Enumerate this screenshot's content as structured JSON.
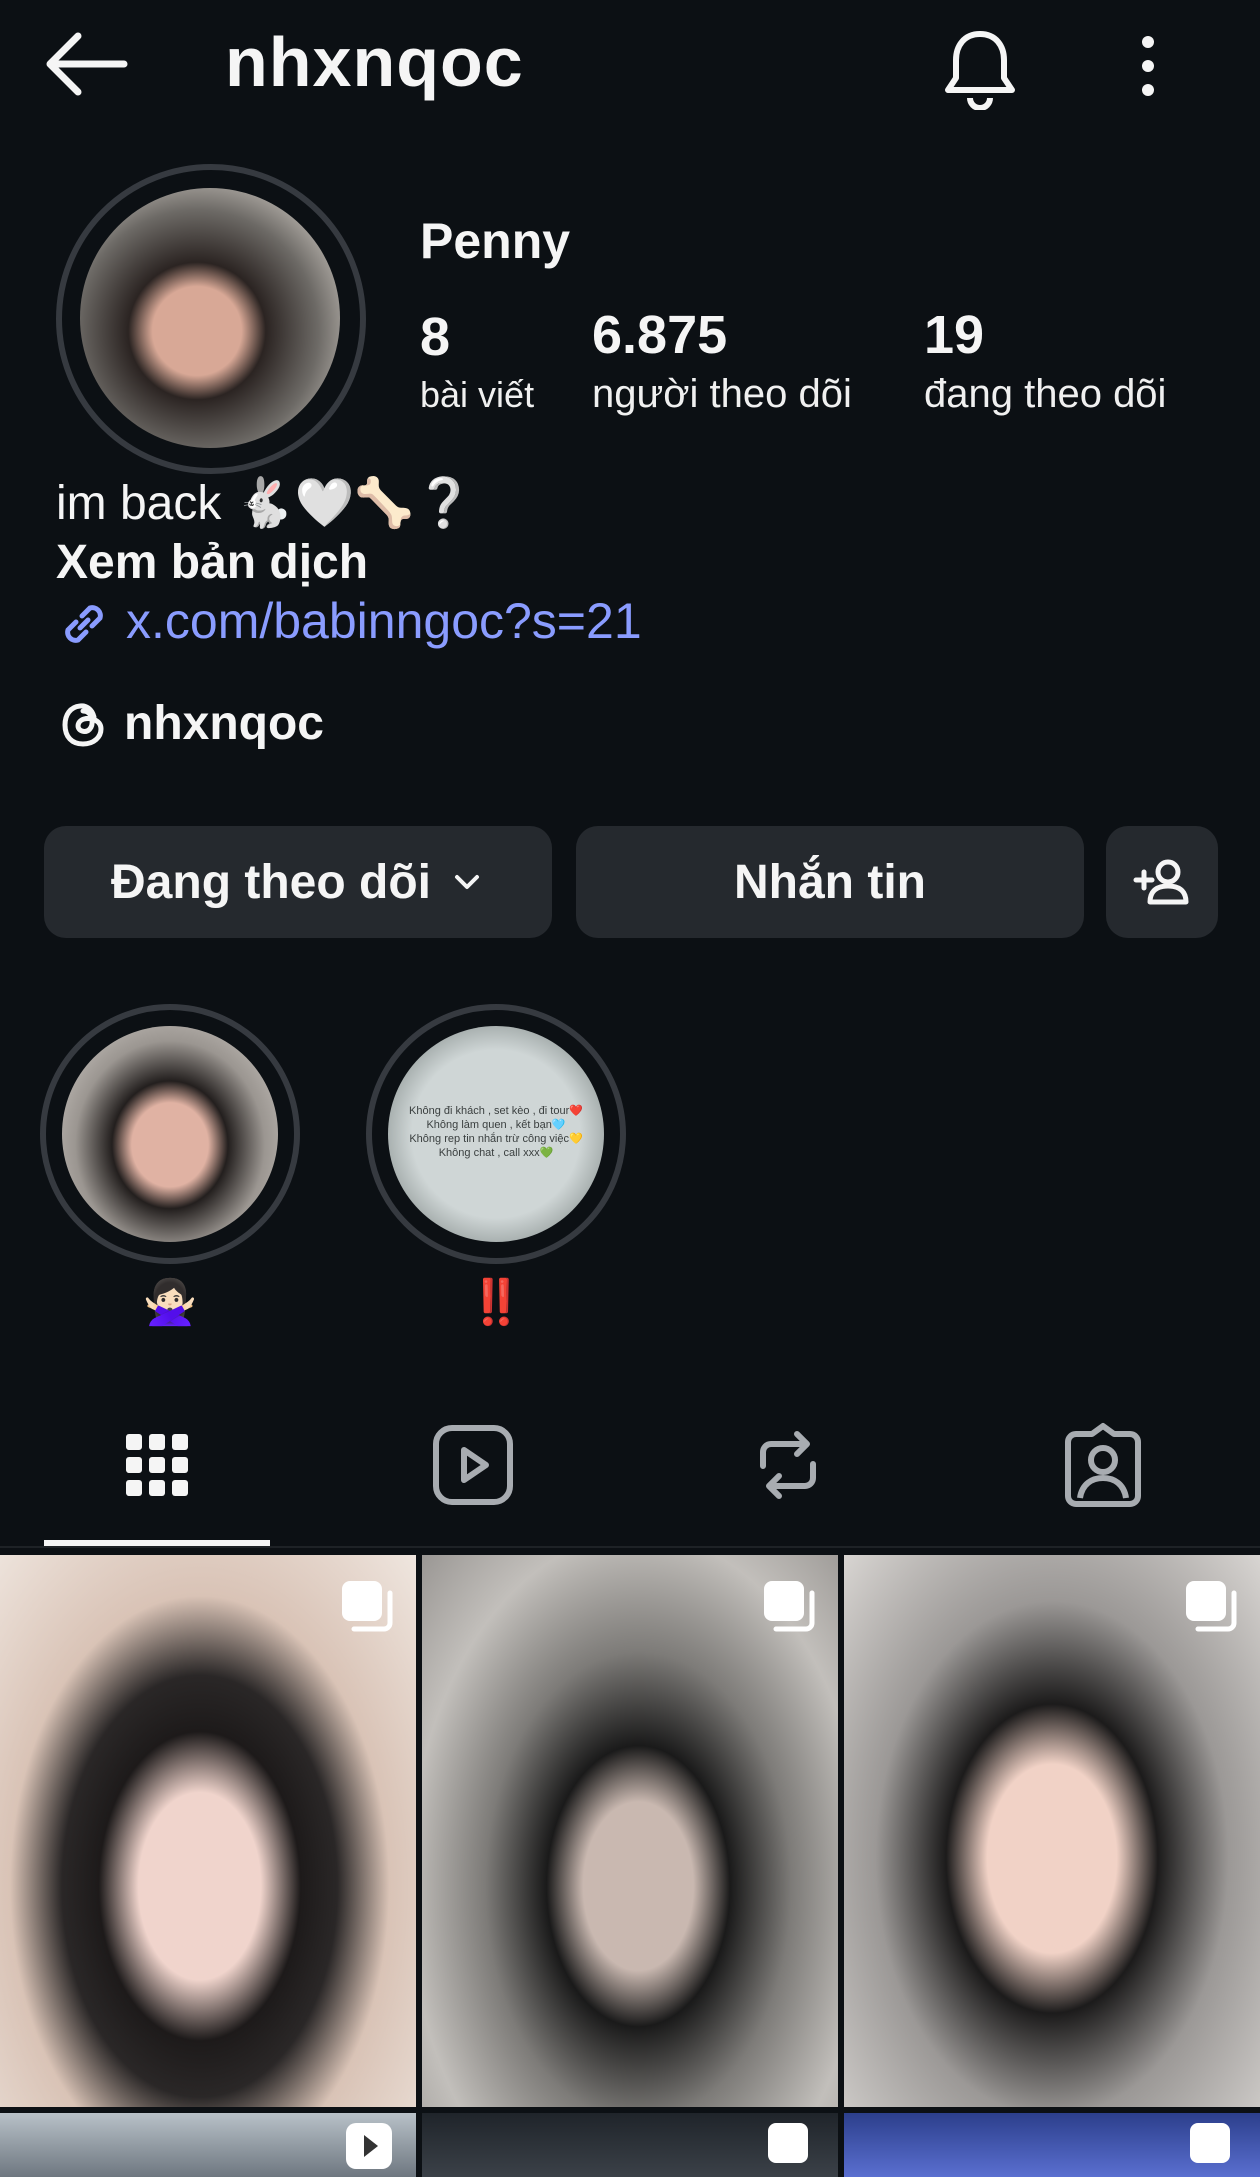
{
  "header": {
    "username": "nhxnqoc",
    "back_icon": "arrow-left-icon",
    "notification_icon": "bell-icon",
    "menu_icon": "more-vertical-icon"
  },
  "profile": {
    "display_name": "Penny",
    "posts_count": "8",
    "posts_label": "bài viết",
    "followers_count": "6.875",
    "followers_label": "người theo dõi",
    "following_count": "19",
    "following_label": "đang theo dõi",
    "bio": "im back 🐇🤍🦴❔",
    "translate_label": "Xem bản dịch",
    "link": "x.com/babinngoc?s=21",
    "threads_handle": "nhxnqoc"
  },
  "actions": {
    "following_label": "Đang theo dõi",
    "message_label": "Nhắn tin",
    "add_user_icon": "add-user-icon"
  },
  "highlights": [
    {
      "label": "🙅🏻‍♀️"
    },
    {
      "label": "‼️",
      "caption_lines": [
        "Không đi khách , set kèo , đi tour❤️",
        "Không làm quen , kết bạn🩵",
        "Không rep tin nhắn trừ công việc💛",
        "Không chat , call xxx💚"
      ]
    }
  ],
  "tabs": [
    "grid-icon",
    "reels-icon",
    "reposts-icon",
    "tagged-icon"
  ],
  "active_tab": 0,
  "colors": {
    "background": "#0c1014",
    "button": "#25292e",
    "link": "#8a9cff"
  }
}
